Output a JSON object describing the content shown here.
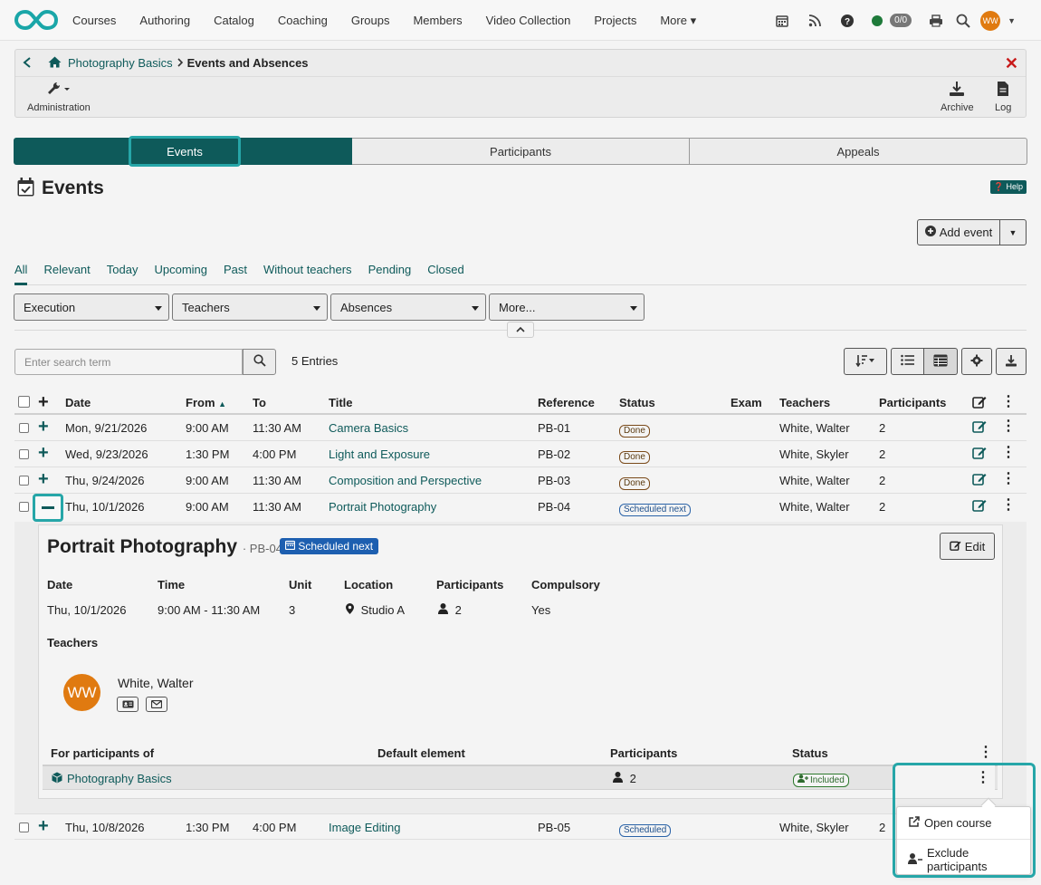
{
  "nav": {
    "items": [
      "Courses",
      "Authoring",
      "Catalog",
      "Coaching",
      "Groups",
      "Members",
      "Video Collection",
      "Projects",
      "More"
    ],
    "badge": "0/0",
    "avatar": "WW"
  },
  "breadcrumb": {
    "course": "Photography Basics",
    "current": "Events and Absences"
  },
  "toolbar": {
    "administration": "Administration",
    "archive": "Archive",
    "log": "Log"
  },
  "segments": [
    "Events",
    "Participants",
    "Appeals"
  ],
  "page": {
    "title": "Events",
    "help": "Help",
    "add_event": "Add event"
  },
  "filter_tabs": [
    "All",
    "Relevant",
    "Today",
    "Upcoming",
    "Past",
    "Without teachers",
    "Pending",
    "Closed"
  ],
  "filters": [
    "Execution",
    "Teachers",
    "Absences",
    "More..."
  ],
  "search": {
    "placeholder": "Enter search term",
    "entries": "5 Entries"
  },
  "table": {
    "headers": {
      "date": "Date",
      "from": "From",
      "to": "To",
      "title": "Title",
      "reference": "Reference",
      "status": "Status",
      "exam": "Exam",
      "teachers": "Teachers",
      "participants": "Participants"
    },
    "rows": [
      {
        "date": "Mon, 9/21/2026",
        "from": "9:00 AM",
        "to": "11:30 AM",
        "title": "Camera Basics",
        "reference": "PB-01",
        "status": "Done",
        "teachers": "White, Walter",
        "participants": "2"
      },
      {
        "date": "Wed, 9/23/2026",
        "from": "1:30 PM",
        "to": "4:00 PM",
        "title": "Light and Exposure",
        "reference": "PB-02",
        "status": "Done",
        "teachers": "White, Skyler",
        "participants": "2"
      },
      {
        "date": "Thu, 9/24/2026",
        "from": "9:00 AM",
        "to": "11:30 AM",
        "title": "Composition and Perspective",
        "reference": "PB-03",
        "status": "Done",
        "teachers": "White, Walter",
        "participants": "2"
      },
      {
        "date": "Thu, 10/1/2026",
        "from": "9:00 AM",
        "to": "11:30 AM",
        "title": "Portrait Photography",
        "reference": "PB-04",
        "status": "Scheduled next",
        "teachers": "White, Walter",
        "participants": "2"
      },
      {
        "date": "Thu, 10/8/2026",
        "from": "1:30 PM",
        "to": "4:00 PM",
        "title": "Image Editing",
        "reference": "PB-05",
        "status": "Scheduled",
        "teachers": "White, Skyler",
        "participants": "2"
      }
    ]
  },
  "detail": {
    "title": "Portrait Photography",
    "ref": "· PB-04",
    "badge": "Scheduled next",
    "edit": "Edit",
    "labels": {
      "date": "Date",
      "time": "Time",
      "unit": "Unit",
      "location": "Location",
      "participants": "Participants",
      "compulsory": "Compulsory"
    },
    "values": {
      "date": "Thu, 10/1/2026",
      "time": "9:00 AM - 11:30 AM",
      "unit": "3",
      "location": "Studio A",
      "participants": "2",
      "compulsory": "Yes"
    },
    "teachers_label": "Teachers",
    "teacher": {
      "name": "White, Walter",
      "initials": "WW"
    },
    "sub_headers": {
      "for": "For participants of",
      "default": "Default element",
      "participants": "Participants",
      "status": "Status"
    },
    "sub_row": {
      "course": "Photography Basics",
      "participants": "2",
      "status": "Included"
    }
  },
  "popup": {
    "open_course": "Open course",
    "exclude": "Exclude participants"
  }
}
